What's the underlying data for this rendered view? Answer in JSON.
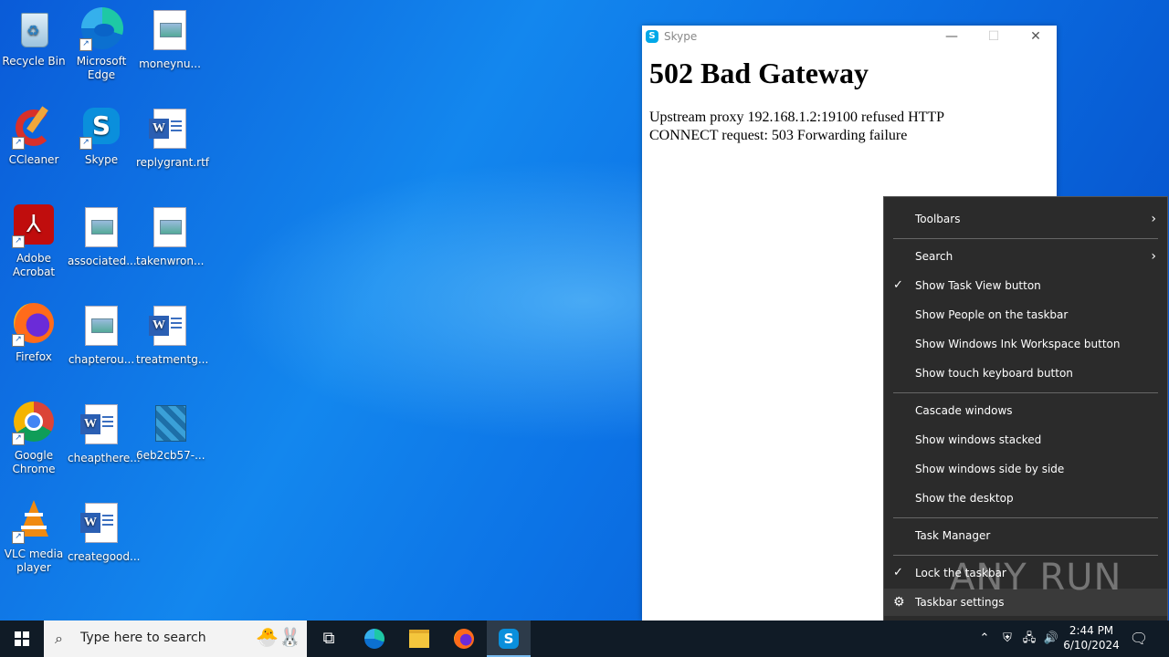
{
  "desktop": {
    "icons": [
      {
        "label": "Recycle Bin",
        "icon": "recycle-bin-icon"
      },
      {
        "label": "Microsoft Edge",
        "icon": "edge-icon"
      },
      {
        "label": "moneynu...",
        "icon": "image-file-icon"
      },
      {
        "label": "CCleaner",
        "icon": "ccleaner-icon"
      },
      {
        "label": "Skype",
        "icon": "skype-icon"
      },
      {
        "label": "replygrant.rtf",
        "icon": "word-doc-icon"
      },
      {
        "label": "Adobe Acrobat",
        "icon": "acrobat-icon"
      },
      {
        "label": "associated...",
        "icon": "image-file-icon"
      },
      {
        "label": "takenwron...",
        "icon": "image-file-icon"
      },
      {
        "label": "Firefox",
        "icon": "firefox-icon"
      },
      {
        "label": "chapterou...",
        "icon": "image-file-icon"
      },
      {
        "label": "treatmentg...",
        "icon": "word-doc-icon"
      },
      {
        "label": "Google Chrome",
        "icon": "chrome-icon"
      },
      {
        "label": "cheapthere...",
        "icon": "word-doc-icon"
      },
      {
        "label": "6eb2cb57-...",
        "icon": "package-icon"
      },
      {
        "label": "VLC media player",
        "icon": "vlc-icon"
      },
      {
        "label": "creategood...",
        "icon": "word-doc-icon"
      }
    ]
  },
  "skype_window": {
    "title": "Skype",
    "minimize": "—",
    "maximize": "☐",
    "close": "✕",
    "heading": "502 Bad Gateway",
    "message": "Upstream proxy 192.168.1.2:19100 refused HTTP CONNECT request: 503 Forwarding failure"
  },
  "context_menu": {
    "items": [
      {
        "label": "Toolbars",
        "checked": false,
        "submenu": true
      },
      {
        "label": "Search",
        "checked": false,
        "submenu": true
      },
      {
        "label": "Show Task View button",
        "checked": true,
        "submenu": false
      },
      {
        "label": "Show People on the taskbar",
        "checked": false,
        "submenu": false
      },
      {
        "label": "Show Windows Ink Workspace button",
        "checked": false,
        "submenu": false
      },
      {
        "label": "Show touch keyboard button",
        "checked": false,
        "submenu": false
      },
      {
        "label": "Cascade windows",
        "checked": false,
        "submenu": false
      },
      {
        "label": "Show windows stacked",
        "checked": false,
        "submenu": false
      },
      {
        "label": "Show windows side by side",
        "checked": false,
        "submenu": false
      },
      {
        "label": "Show the desktop",
        "checked": false,
        "submenu": false
      },
      {
        "label": "Task Manager",
        "checked": false,
        "submenu": false
      },
      {
        "label": "Lock the taskbar",
        "checked": true,
        "submenu": false
      },
      {
        "label": "Taskbar settings",
        "checked": false,
        "submenu": false,
        "icon": "gear-icon"
      }
    ],
    "check_glyph": "✓",
    "submenu_glyph": "›"
  },
  "taskbar": {
    "search_placeholder": "Type here to search",
    "clock_time": "2:44 PM",
    "clock_date": "6/10/2024",
    "pinned": [
      "task-view-icon",
      "edge-icon",
      "file-explorer-icon",
      "firefox-icon",
      "skype-icon"
    ]
  },
  "watermark": "ANY RUN"
}
